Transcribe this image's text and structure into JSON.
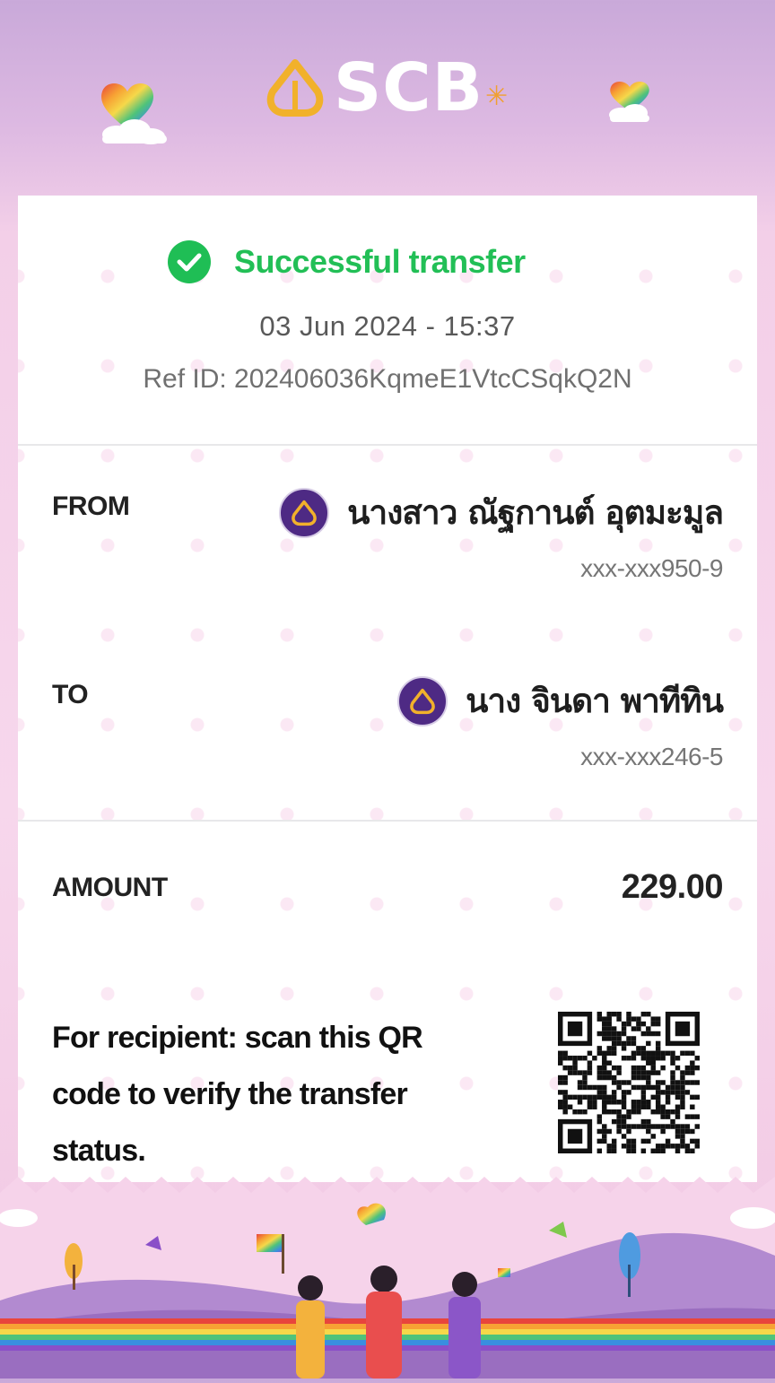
{
  "brand": {
    "name": "SCB",
    "accent": "#4e2a84",
    "logo_gold": "#f1b12b"
  },
  "status": {
    "text": "Successful transfer",
    "color": "#22bf56"
  },
  "datetime": "03  Jun  2024  -  15:37",
  "ref_id": "Ref  ID:  202406036KqmeE1VtcCSqkQ2N",
  "from": {
    "label": "FROM",
    "name": "นางสาว ณัฐกานต์ อุตมะมูล",
    "account": "xxx-xxx950-9"
  },
  "to": {
    "label": "TO",
    "name": "นาง จินดา พาทีทิน",
    "account": "xxx-xxx246-5"
  },
  "amount": {
    "label": "AMOUNT",
    "value": "229.00"
  },
  "qr": {
    "note": "For recipient: scan this QR code to verify the transfer status."
  }
}
